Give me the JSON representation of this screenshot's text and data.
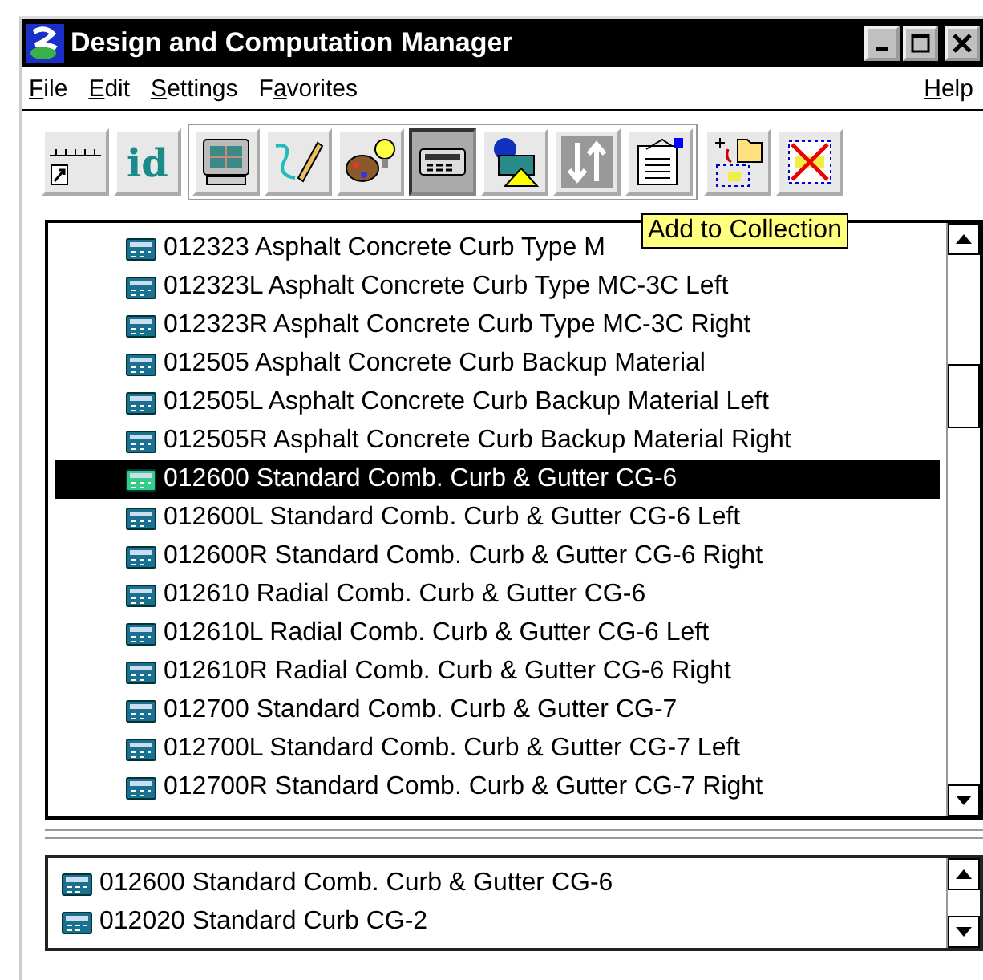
{
  "window": {
    "title": "Design and Computation Manager"
  },
  "menu": [
    {
      "key": "F",
      "after": "ile"
    },
    {
      "key": "E",
      "after": "dit"
    },
    {
      "key": "S",
      "after": "ettings"
    },
    {
      "before": "F",
      "key": "a",
      "after": "vorites"
    }
  ],
  "help_menu": {
    "key": "H",
    "after": "elp"
  },
  "toolbar": [
    {
      "kind": "ruler",
      "pressed": false
    },
    {
      "kind": "id",
      "label": "id",
      "pressed": false
    },
    {
      "kind": "monitor",
      "pressed": false
    },
    {
      "kind": "pencil",
      "pressed": false
    },
    {
      "kind": "palette",
      "pressed": false
    },
    {
      "kind": "calculator",
      "pressed": true
    },
    {
      "kind": "shapes",
      "pressed": false
    },
    {
      "kind": "arrows",
      "pressed": false
    },
    {
      "kind": "clipboard",
      "pressed": false
    },
    {
      "kind": "add",
      "pressed": false
    },
    {
      "kind": "delete",
      "pressed": false
    }
  ],
  "tooltip": "Add to Collection",
  "items": [
    {
      "label": "012323 Asphalt Concrete Curb Type M",
      "selected": false
    },
    {
      "label": "012323L Asphalt Concrete Curb Type MC-3C Left",
      "selected": false
    },
    {
      "label": "012323R Asphalt Concrete Curb Type MC-3C Right",
      "selected": false
    },
    {
      "label": "012505 Asphalt Concrete Curb Backup Material",
      "selected": false
    },
    {
      "label": "012505L Asphalt Concrete Curb Backup Material Left",
      "selected": false
    },
    {
      "label": "012505R Asphalt Concrete Curb Backup Material Right",
      "selected": false
    },
    {
      "label": "012600 Standard Comb. Curb & Gutter CG-6",
      "selected": true
    },
    {
      "label": "012600L Standard Comb. Curb & Gutter CG-6 Left",
      "selected": false
    },
    {
      "label": "012600R Standard Comb. Curb & Gutter CG-6 Right",
      "selected": false
    },
    {
      "label": "012610 Radial Comb. Curb & Gutter CG-6",
      "selected": false
    },
    {
      "label": "012610L Radial Comb. Curb & Gutter CG-6 Left",
      "selected": false
    },
    {
      "label": "012610R Radial Comb. Curb & Gutter CG-6 Right",
      "selected": false
    },
    {
      "label": "012700 Standard Comb. Curb & Gutter CG-7",
      "selected": false
    },
    {
      "label": "012700L Standard Comb. Curb & Gutter CG-7 Left",
      "selected": false
    },
    {
      "label": "012700R Standard Comb. Curb & Gutter CG-7 Right",
      "selected": false
    }
  ],
  "collection": [
    {
      "label": "012600 Standard Comb. Curb & Gutter CG-6"
    },
    {
      "label": "012020 Standard Curb CG-2"
    }
  ]
}
